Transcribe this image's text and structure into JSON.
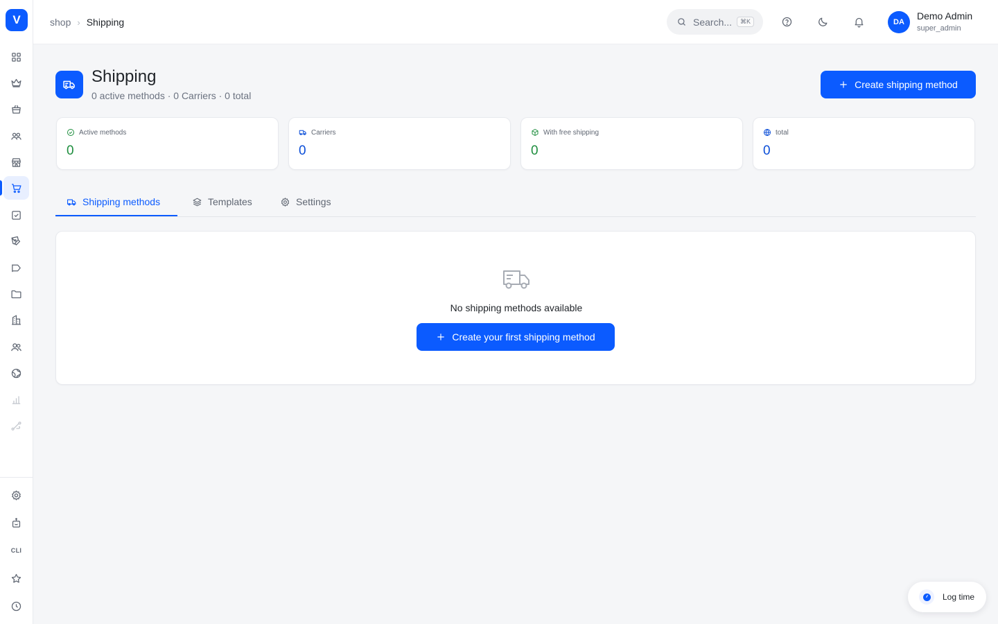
{
  "app": {
    "logo_letter": "V"
  },
  "sidebar": {
    "items": [
      {
        "name": "dashboard-icon"
      },
      {
        "name": "crown-icon"
      },
      {
        "name": "shopping-bag-icon"
      },
      {
        "name": "users-icon"
      },
      {
        "name": "store-icon"
      },
      {
        "name": "shopping-cart-icon",
        "active": true
      },
      {
        "name": "checkbox-icon"
      },
      {
        "name": "pen-tool-icon"
      },
      {
        "name": "megaphone-icon"
      },
      {
        "name": "folder-icon"
      },
      {
        "name": "building-icon"
      },
      {
        "name": "user-group-icon"
      },
      {
        "name": "globe-icon"
      },
      {
        "name": "bar-chart-icon",
        "muted": true
      },
      {
        "name": "route-icon",
        "muted": true
      }
    ],
    "bottom_items": [
      {
        "name": "gear-icon"
      },
      {
        "name": "robot-icon"
      },
      {
        "name": "cli-label",
        "label": "CLI"
      },
      {
        "name": "star-icon"
      },
      {
        "name": "clock-icon"
      }
    ]
  },
  "topbar": {
    "breadcrumb": {
      "parent": "shop",
      "current": "Shipping"
    },
    "search": {
      "placeholder": "Search...",
      "shortcut": "⌘K"
    },
    "user": {
      "initials": "DA",
      "name": "Demo Admin",
      "role": "super_admin"
    }
  },
  "header": {
    "title": "Shipping",
    "subtitle": "0 active methods · 0 Carriers · 0 total",
    "create_button": "Create shipping method"
  },
  "stats": [
    {
      "label": "Active methods",
      "value": "0",
      "icon": "check-circle-icon",
      "color": "#1e8e3e"
    },
    {
      "label": "Carriers",
      "value": "0",
      "icon": "truck-icon",
      "color": "#0b4ed8"
    },
    {
      "label": "With free shipping",
      "value": "0",
      "icon": "package-icon",
      "color": "#1e8e3e"
    },
    {
      "label": "total",
      "value": "0",
      "icon": "globe-icon",
      "color": "#0b4ed8"
    }
  ],
  "tabs": [
    {
      "label": "Shipping methods",
      "icon": "truck-icon",
      "active": true
    },
    {
      "label": "Templates",
      "icon": "layers-icon"
    },
    {
      "label": "Settings",
      "icon": "gear-icon"
    }
  ],
  "empty_state": {
    "icon": "truck-icon",
    "message": "No shipping methods available",
    "button": "Create your first shipping method"
  },
  "floating": {
    "log_time": "Log time"
  },
  "colors": {
    "accent": "#0b5bff",
    "success": "#1e8e3e",
    "info": "#0b4ed8"
  }
}
